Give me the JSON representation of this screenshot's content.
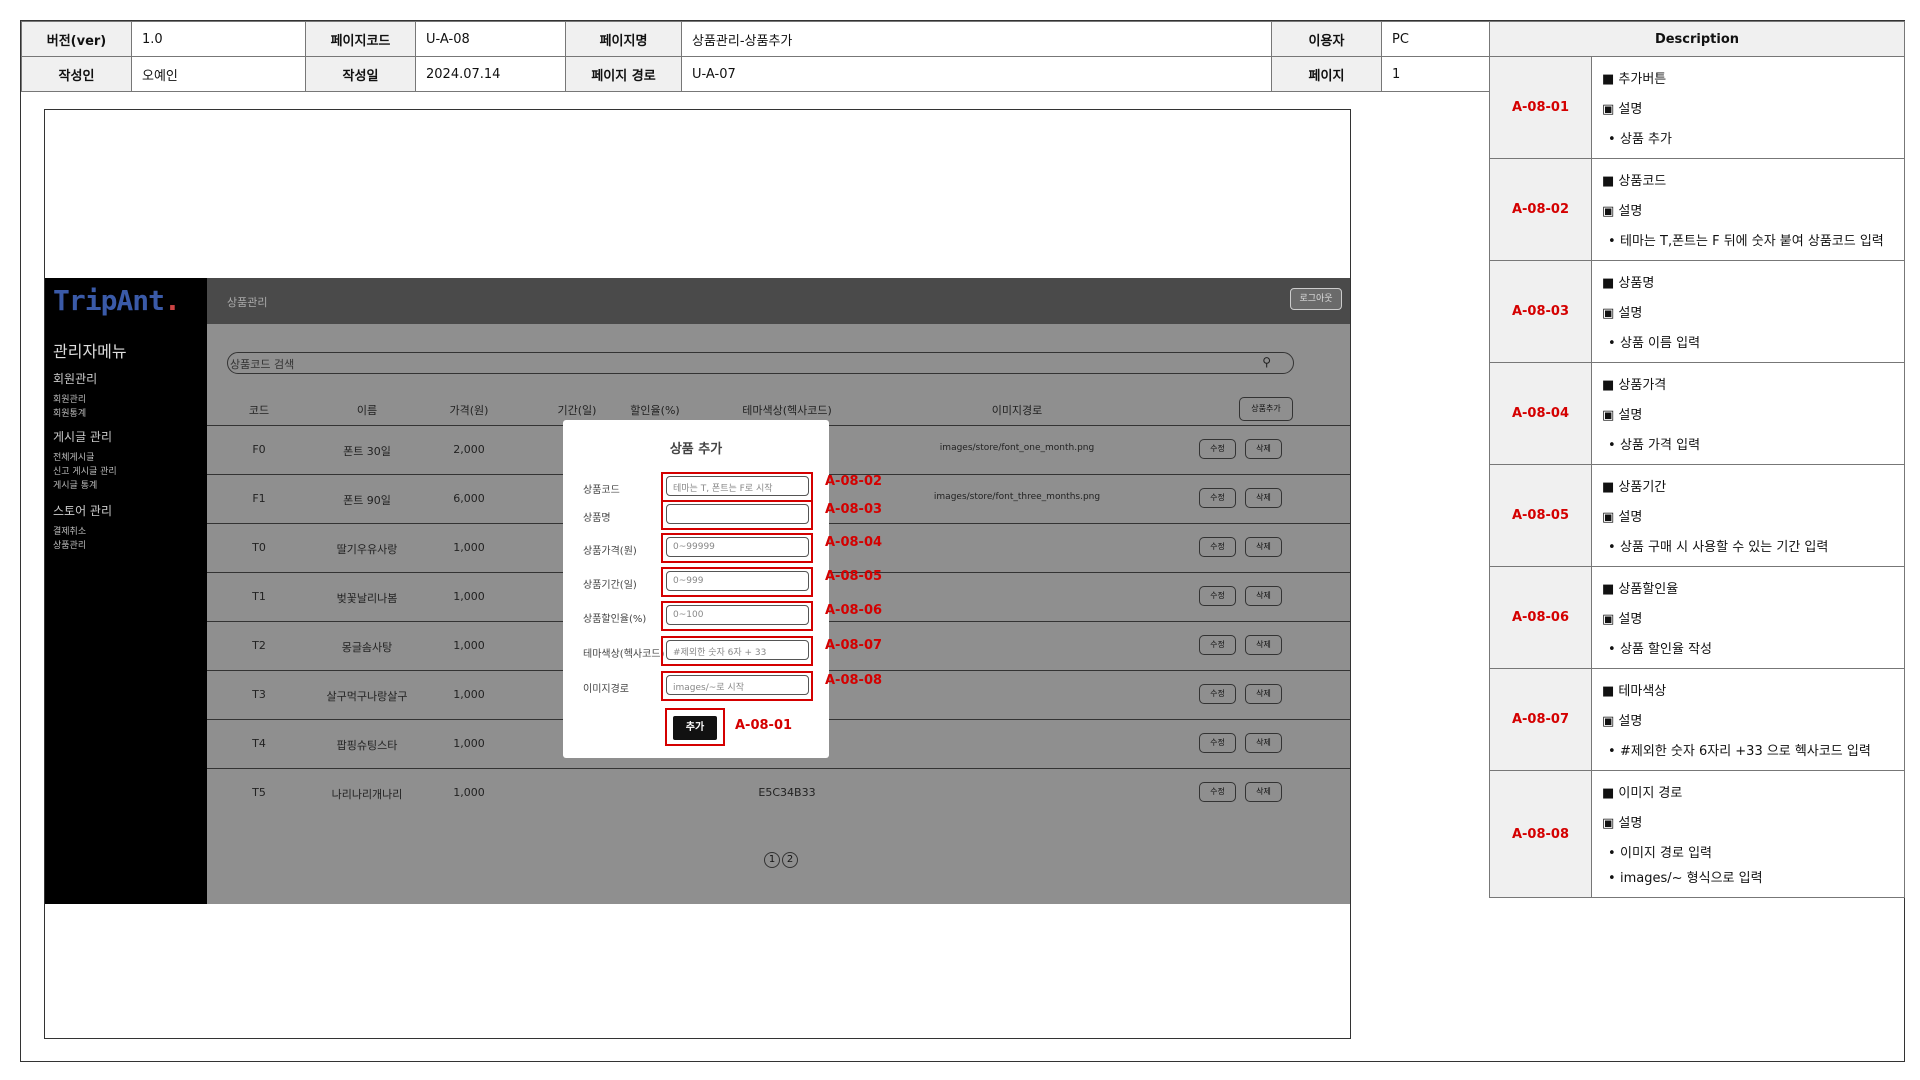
{
  "header": {
    "version_label": "버전(ver)",
    "version": "1.0",
    "pagecode_label": "페이지코드",
    "pagecode": "U-A-08",
    "pagename_label": "페이지명",
    "pagename": "상품관리-상품추가",
    "user_label": "이용자",
    "user": "PC",
    "author_label": "작성인",
    "author": "오예인",
    "date_label": "작성일",
    "date": "2024.07.14",
    "path_label": "페이지 경로",
    "path": "U-A-07",
    "page_label": "페이지",
    "page": "1"
  },
  "description": {
    "title": "Description",
    "items": [
      {
        "code": "A-08-01",
        "head": "■ 추가버튼",
        "sub": "▣ 설명",
        "notes": [
          "상품 추가"
        ]
      },
      {
        "code": "A-08-02",
        "head": "■ 상품코드",
        "sub": "▣ 설명",
        "notes": [
          "테마는 T,폰트는 F 뒤에 숫자 붙여 상품코드 입력"
        ]
      },
      {
        "code": "A-08-03",
        "head": "■ 상품명",
        "sub": "▣ 설명",
        "notes": [
          "상품 이름 입력"
        ]
      },
      {
        "code": "A-08-04",
        "head": "■ 상품가격",
        "sub": "▣ 설명",
        "notes": [
          "상품 가격 입력"
        ]
      },
      {
        "code": "A-08-05",
        "head": "■ 상품기간",
        "sub": "▣ 설명",
        "notes": [
          "상품 구매 시 사용할 수 있는 기간 입력"
        ]
      },
      {
        "code": "A-08-06",
        "head": "■ 상품할인율",
        "sub": "▣ 설명",
        "notes": [
          "상품 할인율 작성"
        ]
      },
      {
        "code": "A-08-07",
        "head": "■ 테마색상",
        "sub": "▣ 설명",
        "notes": [
          "#제외한 숫자 6자리 +33 으로 헥사코드 입력"
        ]
      },
      {
        "code": "A-08-08",
        "head": "■ 이미지 경로",
        "sub": "▣ 설명",
        "notes": [
          "이미지 경로 입력",
          "images/~ 형식으로 입력"
        ]
      }
    ]
  },
  "app": {
    "logo": "TripAnt",
    "logo_dot": ".",
    "sidebar": {
      "title": "관리자메뉴",
      "sections": [
        {
          "label": "회원관리",
          "links": [
            "회원관리",
            "회원통계"
          ]
        },
        {
          "label": "게시글 관리",
          "links": [
            "전체게시글",
            "신고 게시글 관리",
            "게시글 통계"
          ]
        },
        {
          "label": "스토어 관리",
          "links": [
            "결제취소",
            "상품관리"
          ]
        }
      ]
    },
    "topbar_title": "상품관리",
    "logout": "로그아웃",
    "search_placeholder": "상품코드 검색",
    "search_icon": "search-icon",
    "columns": [
      "코드",
      "이름",
      "가격(원)",
      "기간(일)",
      "할인율(%)",
      "테마색상(헥사코드)",
      "이미지경로"
    ],
    "add_button": "상품추가",
    "rows": [
      {
        "code": "F0",
        "name": "폰트 30일",
        "price": "2,000",
        "color": "",
        "path": "images/store/font_one_month.png"
      },
      {
        "code": "F1",
        "name": "폰트 90일",
        "price": "6,000",
        "color": "",
        "path": "images/store/font_three_months.png"
      },
      {
        "code": "T0",
        "name": "딸기우유사랑",
        "price": "1,000",
        "color": "",
        "path": ""
      },
      {
        "code": "T1",
        "name": "벚꽃날리나봄",
        "price": "1,000",
        "color": "",
        "path": ""
      },
      {
        "code": "T2",
        "name": "몽글솜사탕",
        "price": "1,000",
        "color": "",
        "path": ""
      },
      {
        "code": "T3",
        "name": "살구먹구나랑살구",
        "price": "1,000",
        "color": "",
        "path": ""
      },
      {
        "code": "T4",
        "name": "팝핑슈팅스타",
        "price": "1,000",
        "color": "",
        "path": ""
      },
      {
        "code": "T5",
        "name": "나리나리개나리",
        "price": "1,000",
        "color": "E5C34B33",
        "path": ""
      }
    ],
    "edit": "수정",
    "delete": "삭제",
    "pages": [
      "1",
      "2"
    ]
  },
  "modal": {
    "title": "상품 추가",
    "fields": [
      {
        "label": "상품코드",
        "placeholder": "테마는 T, 폰트는 F로 시작",
        "tag": "A-08-02"
      },
      {
        "label": "상품명",
        "placeholder": "",
        "tag": "A-08-03"
      },
      {
        "label": "상품가격(원)",
        "placeholder": "0~99999",
        "tag": "A-08-04"
      },
      {
        "label": "상품기간(일)",
        "placeholder": "0~999",
        "tag": "A-08-05"
      },
      {
        "label": "상품할인율(%)",
        "placeholder": "0~100",
        "tag": "A-08-06"
      },
      {
        "label": "테마색상(헥사코드)",
        "placeholder": "#제외한 숫자 6자 + 33",
        "tag": "A-08-07"
      },
      {
        "label": "이미지경로",
        "placeholder": "images/~로 시작",
        "tag": "A-08-08"
      }
    ],
    "submit": "추가",
    "submit_tag": "A-08-01"
  },
  "colors": {
    "accent": "#d40000",
    "sidebar": "#000000",
    "overlay": "#8f8f8f",
    "topbar": "#4a4a4a"
  }
}
